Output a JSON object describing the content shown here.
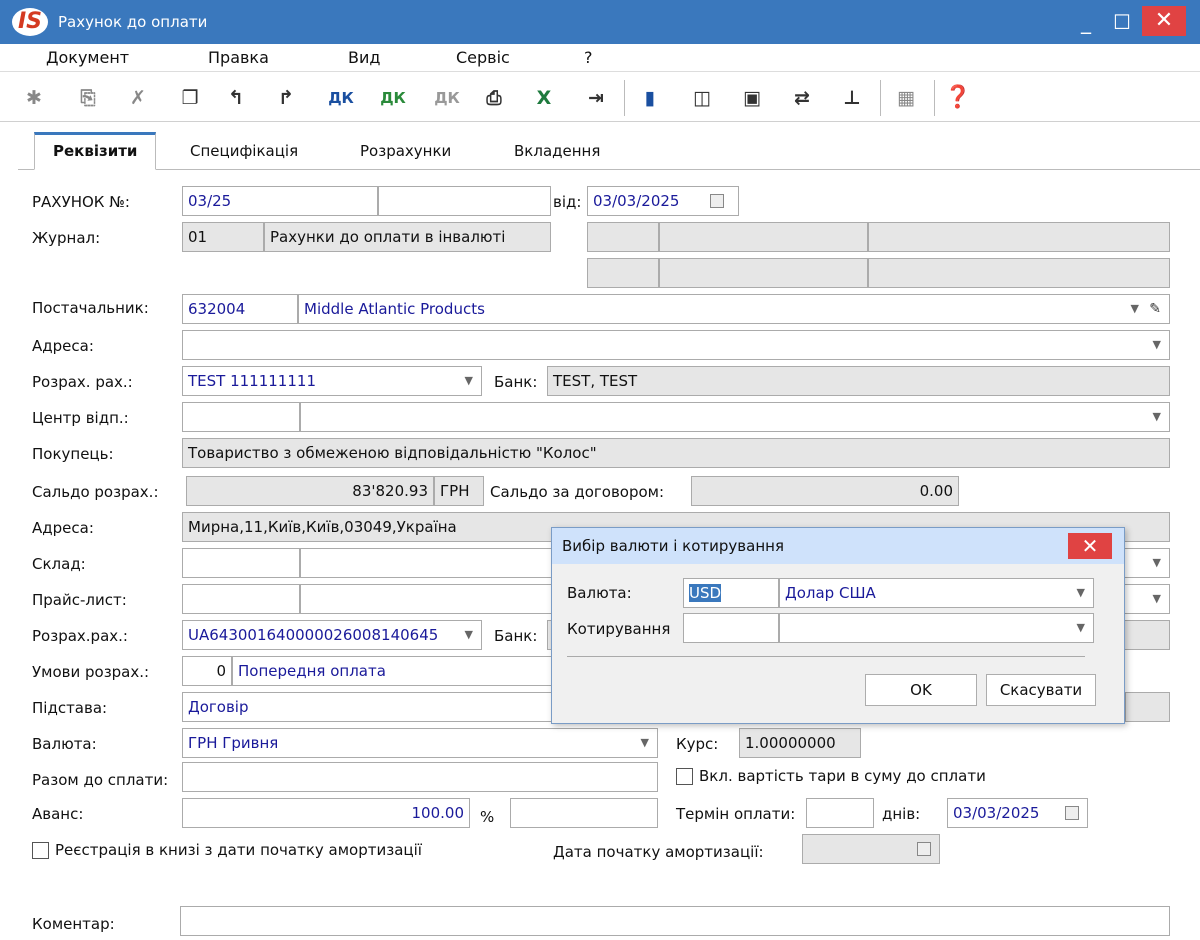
{
  "window": {
    "title": "Рахунок до оплати",
    "logo_text": "IS",
    "min_icon": "minimize-icon",
    "max_icon": "maximize-icon",
    "close_icon": "close-icon"
  },
  "menu": [
    "Документ",
    "Правка",
    "Вид",
    "Сервіс",
    "?"
  ],
  "toolbar": {
    "icons": [
      "new-doc-icon",
      "copy-doc-icon",
      "delete-doc-icon",
      "duplicate-icon",
      "rotate-left-icon",
      "rotate-right-icon",
      "dk-icon",
      "dk-green-icon",
      "dk-gray-icon",
      "print-icon",
      "excel-icon",
      "export-icon",
      "save-icon",
      "book-icon",
      "open-folder-icon",
      "link-icon",
      "tree-icon",
      "grid-icon",
      "help-icon"
    ]
  },
  "tabs": [
    "Реквізити",
    "Специфікація",
    "Розрахунки",
    "Вкладення"
  ],
  "form": {
    "invoice_label": "РАХУНОК №:",
    "invoice_no": "03/25",
    "invoice_no2": "",
    "date_label": "від:",
    "date": "03/03/2025",
    "journal_label": "Журнал:",
    "journal_code": "01",
    "journal_name": "Рахунки до оплати в інвалюті",
    "supplier_label": "Постачальник:",
    "supplier_code": "632004",
    "supplier_name": "Middle Atlantic Products",
    "address_label": "Адреса:",
    "address": "",
    "account_label": "Розрах. рах.:",
    "account": "TEST 111111111",
    "bank_label": "Банк:",
    "bank": "TEST, TEST",
    "center_label": "Центр відп.:",
    "center_code": "",
    "center_name": "",
    "buyer_label": "Покупець:",
    "buyer": "Товариство з обмеженою відповідальністю \"Колос\"",
    "saldo_label": "Сальдо розрах.:",
    "saldo": "83'820.93",
    "saldo_cur": "ГРН",
    "saldo_contract_label": "Сальдо за договором:",
    "saldo_contract": "0.00",
    "address2_label": "Адреса:",
    "address2": "Мирна,11,Київ,Київ,03049,Україна",
    "warehouse_label": "Склад:",
    "pricelist_label": "Прайс-лист:",
    "account2_label": "Розрах.рах.:",
    "account2": "UA643001640000026008140645",
    "bank2_label": "Банк:",
    "terms_label": "Умови розрах.:",
    "terms_code": "0",
    "terms_name": "Попередня оплата",
    "basis_label": "Підстава:",
    "basis": "Договір",
    "currency_label": "Валюта:",
    "currency": "ГРН Гривня",
    "rate_label": "Курс:",
    "rate": "1.00000000",
    "total_label": "Разом до сплати:",
    "total": "",
    "tare_label": "Вкл. вартість тари в суму до сплати",
    "advance_label": "Аванс:",
    "advance": "100.00",
    "percent": "%",
    "due_label": "Термін оплати:",
    "due_days": "",
    "days_label": "днів:",
    "due_date": "03/03/2025",
    "reg_label": "Реєстрація в книзі з дати початку амортизації",
    "amort_label": "Дата початку амортизації:",
    "amort_date": "",
    "comment_label": "Коментар:",
    "comment": ""
  },
  "dialog": {
    "title": "Вибір валюти і котирування",
    "currency_label": "Валюта:",
    "currency_code": "USD",
    "currency_name": "Долар США",
    "quote_label": "Котирування",
    "quote_code": "",
    "quote_name": "",
    "ok": "OK",
    "cancel": "Скасувати"
  },
  "colors": {
    "titlebar": "#3a78bd",
    "close": "#e04343",
    "field_text": "#1a1a9a"
  }
}
